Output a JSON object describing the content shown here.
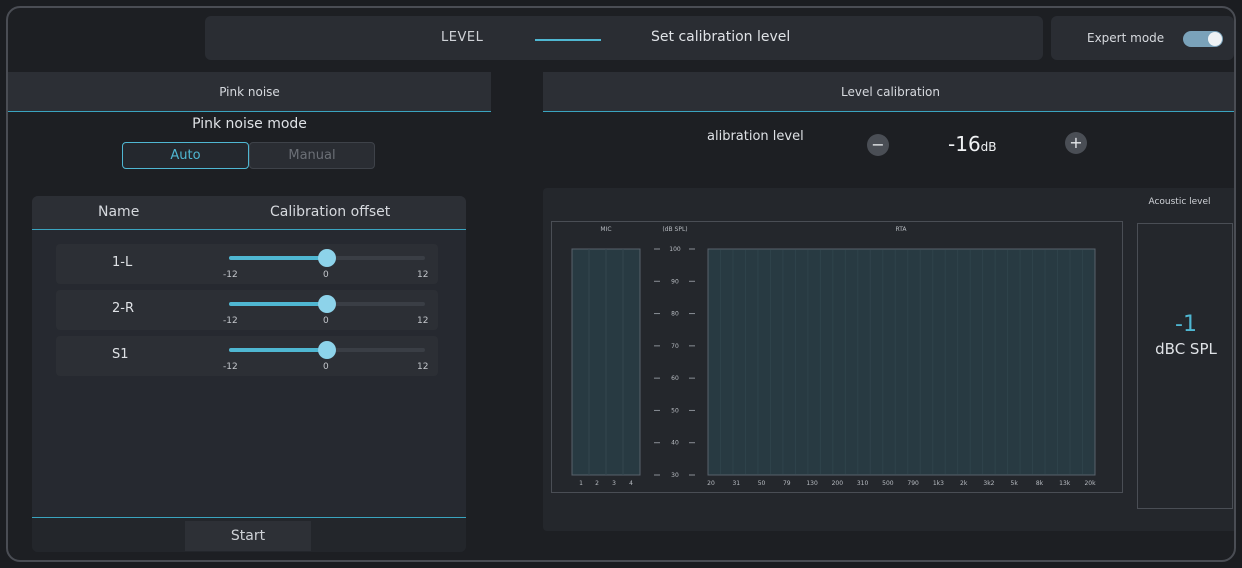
{
  "header": {
    "step_label": "LEVEL",
    "step_title": "Set calibration level",
    "expert_mode_label": "Expert mode",
    "expert_mode_on": true
  },
  "pink_noise": {
    "panel_title": "Pink noise",
    "mode_title": "Pink noise mode",
    "modes": [
      "Auto",
      "Manual"
    ],
    "selected_mode": "Auto",
    "columns": [
      "Name",
      "Calibration offset"
    ],
    "rows": [
      {
        "name": "1-L",
        "offset": 0,
        "min": "-12",
        "mid": "0",
        "max": "12"
      },
      {
        "name": "2-R",
        "offset": 0,
        "min": "-12",
        "mid": "0",
        "max": "12"
      },
      {
        "name": "S1",
        "offset": 0,
        "min": "-12",
        "mid": "0",
        "max": "12"
      }
    ],
    "start_label": "Start"
  },
  "level_calibration": {
    "panel_title": "Level calibration",
    "calibration_label": "alibration level",
    "value": "-16",
    "unit": "dB",
    "mic_label": "MIC",
    "scale_label": "(dB SPL)",
    "rta_label": "RTA",
    "mic_channels": [
      "1",
      "2",
      "3",
      "4"
    ],
    "scale_ticks": [
      "100",
      "90",
      "80",
      "70",
      "60",
      "50",
      "40",
      "30"
    ],
    "rta_freqs": [
      "20",
      "31",
      "50",
      "79",
      "130",
      "200",
      "310",
      "500",
      "790",
      "1k3",
      "2k",
      "3k2",
      "5k",
      "8k",
      "13k",
      "20k"
    ],
    "acoustic_title": "Acoustic level",
    "acoustic_value": "-1",
    "acoustic_unit": "dBC SPL"
  },
  "colors": {
    "accent": "#4fb7d2",
    "background": "#1d1f23",
    "panel": "#2c2f35"
  }
}
